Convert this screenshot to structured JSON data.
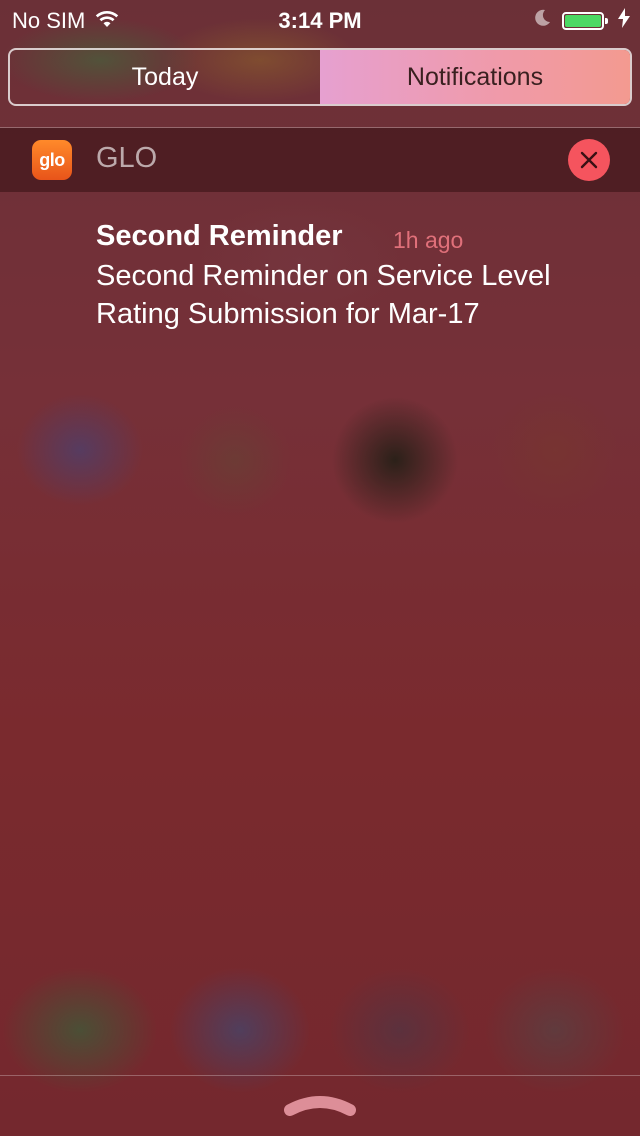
{
  "status_bar": {
    "carrier": "No SIM",
    "time": "3:14 PM",
    "battery_level": 1.0,
    "battery_color": "#4cd964"
  },
  "segmented_control": {
    "segments": [
      {
        "label": "Today",
        "selected": false
      },
      {
        "label": "Notifications",
        "selected": true
      }
    ]
  },
  "app_section": {
    "icon_text": "glo",
    "app_name": "GLO",
    "clear_icon": "close-icon"
  },
  "notifications": [
    {
      "title": "Second Reminder",
      "time": "1h ago",
      "body": "Second Reminder on Service Level Rating Submission for Mar-17"
    }
  ],
  "colors": {
    "accent_clear": "#f5545e",
    "timestamp": "#e0707a",
    "app_icon": "#f26b22"
  }
}
